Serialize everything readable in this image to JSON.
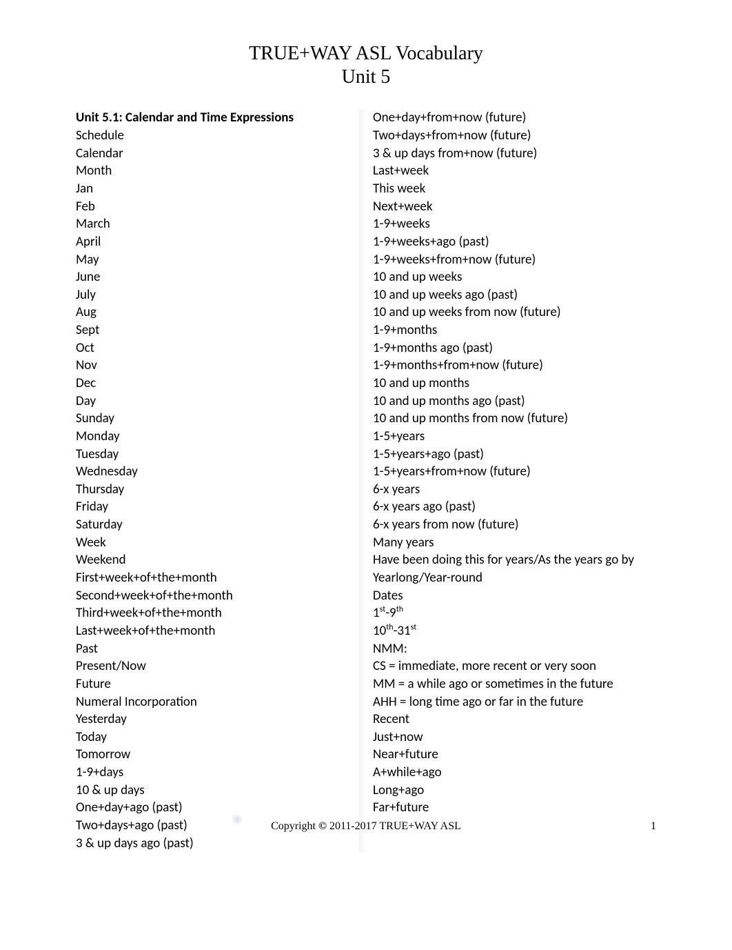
{
  "header": {
    "title": "TRUE+WAY ASL Vocabulary",
    "subtitle": "Unit 5"
  },
  "left_column": {
    "section_title": "Unit 5.1: Calendar and Time Expressions",
    "items": [
      "Schedule",
      "Calendar",
      "Month",
      "Jan",
      "Feb",
      "March",
      "April",
      "May",
      "June",
      "July",
      "Aug",
      "Sept",
      "Oct",
      "Nov",
      "Dec",
      "Day",
      "Sunday",
      "Monday",
      "Tuesday",
      "Wednesday",
      "Thursday",
      "Friday",
      "Saturday",
      "Week",
      "Weekend",
      "First+week+of+the+month",
      "Second+week+of+the+month",
      "Third+week+of+the+month",
      "Last+week+of+the+month",
      "Past",
      "Present/Now",
      "Future",
      "Numeral Incorporation",
      "Yesterday",
      "Today",
      "Tomorrow",
      "1-9+days",
      "10 & up days",
      "One+day+ago (past)",
      "Two+days+ago (past)",
      "3 & up days ago (past)"
    ]
  },
  "right_column": {
    "items_before_ordinals": [
      "One+day+from+now (future)",
      "Two+days+from+now (future)",
      "3 & up days from+now (future)",
      "Last+week",
      "This week",
      "Next+week",
      "1-9+weeks",
      "1-9+weeks+ago (past)",
      "1-9+weeks+from+now (future)",
      "10 and up weeks",
      "10 and up weeks ago (past)",
      "10 and up weeks from now (future)",
      "1-9+months",
      "1-9+months ago (past)",
      "1-9+months+from+now (future)",
      "10 and up months",
      "10 and up months ago (past)",
      "10 and up months from now (future)",
      "1-5+years",
      "1-5+years+ago (past)",
      "1-5+years+from+now (future)",
      "6-x years",
      "6-x years ago (past)",
      "6-x years from now (future)",
      "Many years",
      "Have been doing this for years/As the years go by",
      "Yearlong/Year-round",
      "Dates"
    ],
    "ordinal1": {
      "a": "1",
      "a_sup": "st",
      "sep": "-",
      "b": "9",
      "b_sup": "th"
    },
    "ordinal2": {
      "a": "10",
      "a_sup": "th",
      "sep": "-",
      "b": "31",
      "b_sup": "st"
    },
    "items_after_ordinals": [
      "NMM:",
      "CS = immediate, more recent or very soon",
      "MM = a while ago or sometimes in the future",
      "AHH = long time ago or far in the future",
      "Recent",
      "Just+now",
      "Near+future",
      "A+while+ago",
      "Long+ago",
      "Far+future"
    ]
  },
  "footer": {
    "copyright_prefix": "Copyright ",
    "copyright_symbol": "©",
    "copyright_suffix": " 2011-2017 TRUE+WAY ASL",
    "page": "1"
  }
}
